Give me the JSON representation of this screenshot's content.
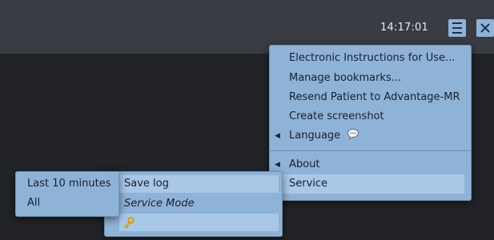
{
  "topbar": {
    "clock": "14:17:01",
    "menu_icon": "hamburger-menu-icon",
    "close_icon": "close-icon",
    "button_color": "#8fb3d9"
  },
  "main_menu": {
    "items": [
      {
        "label": "Electronic Instructions for Use...",
        "has_submenu": false
      },
      {
        "label": "Manage bookmarks...",
        "has_submenu": false
      },
      {
        "label": "Resend Patient to Advantage-MR",
        "has_submenu": false
      },
      {
        "label": "Create screenshot",
        "has_submenu": false
      },
      {
        "label": "Language",
        "has_submenu": true,
        "icon": "speech-bubble-icon"
      },
      {
        "label": "About",
        "has_submenu": true
      },
      {
        "label": "Service",
        "has_submenu": false,
        "active": true
      }
    ]
  },
  "service_menu": {
    "items": [
      {
        "label": "Save log",
        "highlighted": true
      },
      {
        "label": "Service Mode",
        "italic": true
      },
      {
        "label": "",
        "icon": "key-icon",
        "highlighted": true
      }
    ]
  },
  "log_menu": {
    "items": [
      {
        "label": "Last 10 minutes"
      },
      {
        "label": "All"
      }
    ]
  },
  "colors": {
    "menu_bg": "#8fb3d6",
    "menu_highlight": "#a9c7e7",
    "topbar": "#393c43",
    "background": "#222326"
  }
}
